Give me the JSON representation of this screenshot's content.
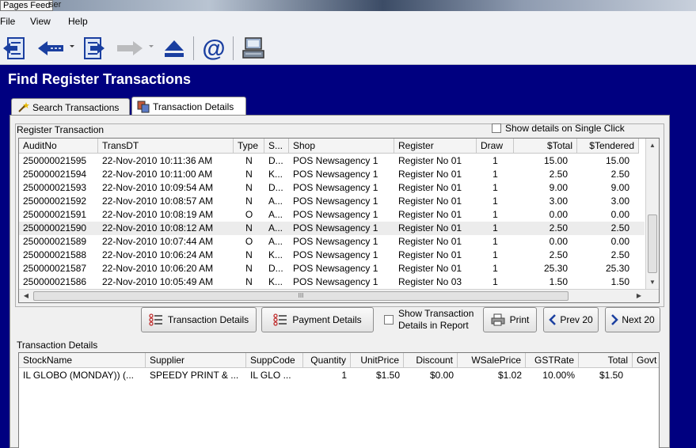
{
  "window": {
    "tooltip": "Pages Feed",
    "title_tail": "ser"
  },
  "menu": {
    "file": "File",
    "view": "View",
    "help": "Help"
  },
  "toolbar": {
    "buttons": [
      "exit-icon",
      "back-icon",
      "edit-icon",
      "forward-icon",
      "eject-icon",
      "email-icon",
      "register-icon"
    ]
  },
  "page_title": "Find Register Transactions",
  "tabs": {
    "search": "Search Transactions",
    "details": "Transaction Details"
  },
  "register": {
    "label": "Register Transaction",
    "single_click_label": "Show details on Single Click",
    "columns": [
      "AuditNo",
      "TransDT",
      "Type",
      "S...",
      "Shop",
      "Register",
      "Draw",
      "$Total",
      "$Tendered"
    ],
    "rows": [
      [
        "250000021595",
        "22-Nov-2010 10:11:36 AM",
        "N",
        "D...",
        "POS Newsagency 1",
        "Register No 01",
        "1",
        "15.00",
        "15.00"
      ],
      [
        "250000021594",
        "22-Nov-2010 10:11:00 AM",
        "N",
        "K...",
        "POS Newsagency 1",
        "Register No 01",
        "1",
        "2.50",
        "2.50"
      ],
      [
        "250000021593",
        "22-Nov-2010 10:09:54 AM",
        "N",
        "D...",
        "POS Newsagency 1",
        "Register No 01",
        "1",
        "9.00",
        "9.00"
      ],
      [
        "250000021592",
        "22-Nov-2010 10:08:57 AM",
        "N",
        "A...",
        "POS Newsagency 1",
        "Register No 01",
        "1",
        "3.00",
        "3.00"
      ],
      [
        "250000021591",
        "22-Nov-2010 10:08:19 AM",
        "O",
        "A...",
        "POS Newsagency 1",
        "Register No 01",
        "1",
        "0.00",
        "0.00"
      ],
      [
        "250000021590",
        "22-Nov-2010 10:08:12 AM",
        "N",
        "A...",
        "POS Newsagency 1",
        "Register No 01",
        "1",
        "2.50",
        "2.50"
      ],
      [
        "250000021589",
        "22-Nov-2010 10:07:44 AM",
        "O",
        "A...",
        "POS Newsagency 1",
        "Register No 01",
        "1",
        "0.00",
        "0.00"
      ],
      [
        "250000021588",
        "22-Nov-2010 10:06:24 AM",
        "N",
        "K...",
        "POS Newsagency 1",
        "Register No 01",
        "1",
        "2.50",
        "2.50"
      ],
      [
        "250000021587",
        "22-Nov-2010 10:06:20 AM",
        "N",
        "D...",
        "POS Newsagency 1",
        "Register No 01",
        "1",
        "25.30",
        "25.30"
      ],
      [
        "250000021586",
        "22-Nov-2010 10:05:49 AM",
        "N",
        "K...",
        "POS Newsagency 1",
        "Register No 03",
        "1",
        "1.50",
        "1.50"
      ]
    ],
    "selected_row": 5,
    "hscroll_grip": "III"
  },
  "buttons": {
    "transaction_details": "Transaction Details",
    "payment_details": "Payment Details",
    "show_tx_line1": "Show Transaction",
    "show_tx_line2": "Details in Report",
    "print": "Print",
    "prev": "Prev 20",
    "next": "Next 20"
  },
  "details": {
    "label": "Transaction Details",
    "columns": [
      "StockName",
      "Supplier",
      "SuppCode",
      "Quantity",
      "UnitPrice",
      "Discount",
      "WSalePrice",
      "GSTRate",
      "Total",
      "Govt"
    ],
    "rows": [
      [
        "IL GLOBO (MONDAY))  (...",
        "SPEEDY PRINT & ...",
        "IL GLO ...",
        "1",
        "$1.50",
        "$0.00",
        "$1.02",
        "10.00%",
        "$1.50",
        ""
      ]
    ]
  }
}
